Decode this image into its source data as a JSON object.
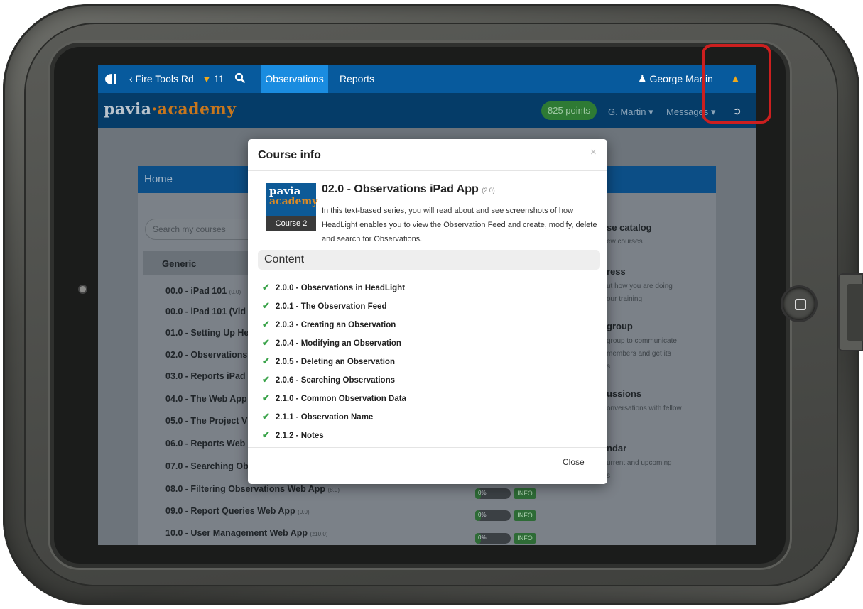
{
  "nav": {
    "back": "‹ Fire Tools Rd",
    "filter_icon": "filter-icon",
    "filter_count": "11",
    "tab_observations": "Observations",
    "tab_reports": "Reports",
    "user": "George Martin",
    "user_icon": "person-icon",
    "cap_icon": "graduation-cap-icon"
  },
  "brand": {
    "part1": "pavia",
    "dot": "·",
    "part2": "academy"
  },
  "account": {
    "points": "825 points",
    "name": "G. Martin",
    "name_caret": "▾",
    "messages": "Messages",
    "messages_caret": "▾"
  },
  "home": {
    "title": "Home",
    "search_placeholder": "Search my courses",
    "group": "Generic",
    "courses": [
      {
        "name": "00.0 - iPad 101",
        "ver": "(0.0)"
      },
      {
        "name": "00.0 - iPad 101 (Vid",
        "ver": ""
      },
      {
        "name": "01.0 - Setting Up He",
        "ver": ""
      },
      {
        "name": "02.0 - Observations",
        "ver": ""
      },
      {
        "name": "03.0 - Reports iPad",
        "ver": ""
      },
      {
        "name": "04.0 - The Web App",
        "ver": ""
      },
      {
        "name": "05.0 - The Project V",
        "ver": ""
      },
      {
        "name": "06.0 - Reports Web",
        "ver": ""
      },
      {
        "name": "07.0 - Searching Ob",
        "ver": ""
      },
      {
        "name": "08.0 - Filtering Observations Web App",
        "ver": "(8.0)",
        "progress": "0%",
        "info": "INFO"
      },
      {
        "name": "09.0 - Report Queries Web App",
        "ver": "(9.0)",
        "progress": "0%",
        "info": "INFO"
      },
      {
        "name": "10.0 - User Management Web App",
        "ver": "(z10.0)",
        "progress": "0%",
        "info": "INFO"
      }
    ],
    "right": [
      {
        "title": "se catalog",
        "lines": [
          "ew courses"
        ]
      },
      {
        "title": "ress",
        "lines": [
          "ut how you are doing",
          "our training"
        ]
      },
      {
        "title": "group",
        "lines": [
          "group to communicate",
          "members and get its",
          "s"
        ]
      },
      {
        "title": "ussions",
        "lines": [
          "onversations with fellow"
        ]
      },
      {
        "title": "ndar",
        "lines": [
          "urrent and upcoming",
          "s"
        ]
      }
    ]
  },
  "modal": {
    "title": "Course info",
    "close_x": "×",
    "badge_line1": "pavia",
    "badge_line2": "academy",
    "badge_label": "Course 2",
    "course_title": "02.0 - Observations iPad App",
    "course_ver": "(2.0)",
    "description": "In this text-based series, you will read about and see screenshots of how HeadLight enables you to view the Observation Feed and create, modify, delete and search for Observations.",
    "content_heading": "Content",
    "check_icon": "checkmark-icon",
    "lessons": [
      "2.0.0 - Observations in HeadLight",
      "2.0.1 - The Observation Feed",
      "2.0.3 - Creating an Observation",
      "2.0.4 - Modifying an Observation",
      "2.0.5 - Deleting an Observation",
      "2.0.6 - Searching Observations",
      "2.1.0 - Common Observation Data",
      "2.1.1 - Observation Name",
      "2.1.2 - Notes"
    ],
    "close_label": "Close"
  },
  "colors": {
    "nav_blue": "#075a9d",
    "active_tab": "#1a8ce0",
    "brand_orange": "#c7761d",
    "check_green": "#3aa34a",
    "highlight_red": "#cc1f1f"
  }
}
